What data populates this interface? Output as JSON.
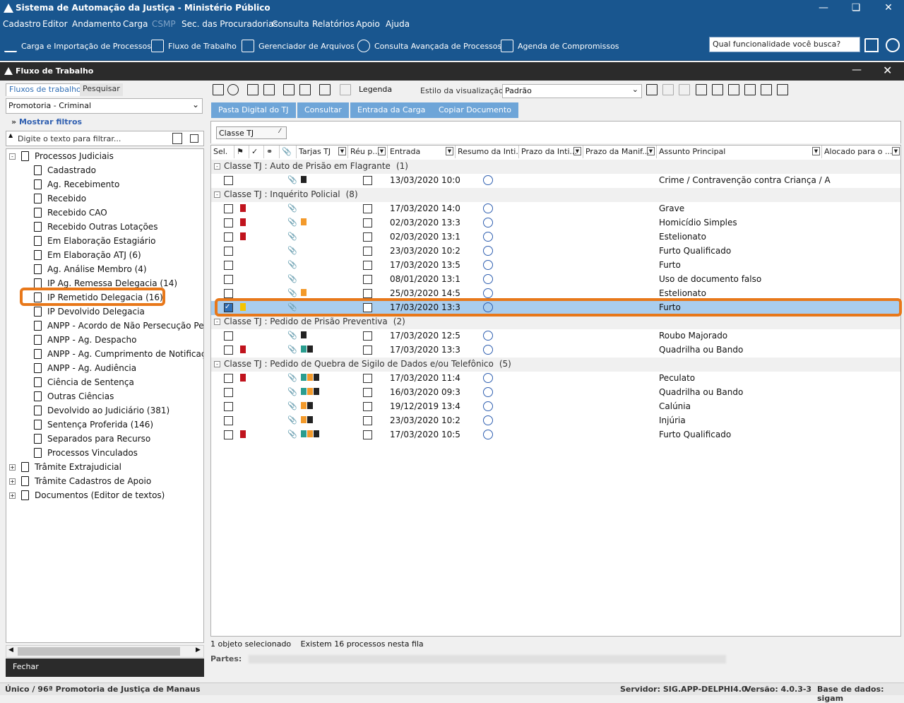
{
  "window": {
    "title": "Sistema de Automação da Justiça - Ministério Público"
  },
  "menu": [
    "Cadastro",
    "Editor",
    "Andamento",
    "Carga",
    "CSMP",
    "Sec. das Procuradorias",
    "Consulta",
    "Relatórios",
    "Apoio",
    "Ajuda"
  ],
  "toolbar": {
    "items": [
      "Carga e Importação de Processos",
      "Fluxo de Trabalho",
      "Gerenciador de Arquivos",
      "Consulta Avançada de Processos",
      "Agenda de Compromissos"
    ],
    "search_placeholder": "Qual funcionalidade você busca?"
  },
  "panel": {
    "title": "Fluxo de Trabalho"
  },
  "left": {
    "tabs": [
      "Fluxos de trabalho",
      "Pesquisar"
    ],
    "combo_value": "Promotoria - Criminal",
    "filters_label": "Mostrar filtros",
    "filter_placeholder": "Digite o texto para filtrar...",
    "tree_root": "Processos Judiciais",
    "tree_items": [
      "Cadastrado",
      "Ag. Recebimento",
      "Recebido",
      "Recebido CAO",
      "Recebido Outras Lotações",
      "Em Elaboração Estagiário",
      "Em Elaboração ATJ (6)",
      "Ag. Análise Membro (4)",
      "IP Ag. Remessa Delegacia (14)",
      "IP Remetido Delegacia (16)",
      "IP Devolvido Delegacia",
      "ANPP - Acordo de Não Persecução Penal",
      "ANPP - Ag. Despacho",
      "ANPP - Ag. Cumprimento de Notificações",
      "ANPP - Ag. Audiência",
      "Ciência de Sentença",
      "Outras Ciências",
      "Devolvido ao Judiciário (381)",
      "Sentença Proferida (146)",
      "Separados para Recurso",
      "Processos Vinculados"
    ],
    "tree_other": [
      "Trâmite Extrajudicial",
      "Trâmite Cadastros de Apoio",
      "Documentos (Editor de textos)"
    ],
    "close_label": "Fechar"
  },
  "right": {
    "legend_label": "Legenda",
    "view_style_label": "Estilo da visualização",
    "view_style_value": "Padrão",
    "buttons": [
      "Pasta Digital do TJ",
      "Consultar",
      "Entrada da Carga",
      "Copiar Documento"
    ],
    "group_chip": "Classe TJ",
    "columns": [
      "Sel.",
      "Tarjas TJ",
      "Réu p...",
      "Entrada",
      "Resumo da Inti...",
      "Prazo da Inti...",
      "Prazo da Manif...",
      "Assunto Principal",
      "Alocado para o ..."
    ],
    "groups": [
      {
        "label": "Classe TJ : Auto de Prisão em Flagrante",
        "count": "(1)",
        "rows": [
          {
            "date": "13/03/2020 10:0",
            "subject": "Crime / Contravenção contra Criança / A",
            "flag": false,
            "tags": [
              "#222222"
            ],
            "checked": false
          }
        ]
      },
      {
        "label": "Classe TJ : Inquérito Policial",
        "count": "(8)",
        "rows": [
          {
            "date": "17/03/2020 14:0",
            "subject": "Grave",
            "flag": true,
            "tags": [],
            "checked": false
          },
          {
            "date": "02/03/2020 13:3",
            "subject": "Homicídio Simples",
            "flag": true,
            "tags": [
              "#f39a2b"
            ],
            "checked": false
          },
          {
            "date": "02/03/2020 13:1",
            "subject": "Estelionato",
            "flag": true,
            "tags": [],
            "checked": false
          },
          {
            "date": "23/03/2020 10:2",
            "subject": "Furto Qualificado",
            "flag": false,
            "tags": [],
            "checked": false
          },
          {
            "date": "17/03/2020 13:5",
            "subject": "Furto",
            "flag": false,
            "tags": [],
            "checked": false
          },
          {
            "date": "08/01/2020 13:1",
            "subject": "Uso de documento falso",
            "flag": false,
            "tags": [],
            "checked": false
          },
          {
            "date": "25/03/2020 14:5",
            "subject": "Estelionato",
            "flag": false,
            "tags": [
              "#f39a2b"
            ],
            "checked": false
          },
          {
            "date": "17/03/2020 13:3",
            "subject": "Furto",
            "flag": false,
            "tags": [],
            "checked": true
          }
        ]
      },
      {
        "label": "Classe TJ : Pedido de Prisão Preventiva",
        "count": "(2)",
        "rows": [
          {
            "date": "17/03/2020 12:5",
            "subject": "Roubo Majorado",
            "flag": false,
            "tags": [
              "#222222"
            ],
            "checked": false
          },
          {
            "date": "17/03/2020 13:3",
            "subject": "Quadrilha ou Bando",
            "flag": true,
            "tags": [
              "#2a9d8f",
              "#222222"
            ],
            "checked": false
          }
        ]
      },
      {
        "label": "Classe TJ : Pedido de Quebra de Sigilo de Dados e/ou Telefônico",
        "count": "(5)",
        "rows": [
          {
            "date": "17/03/2020 11:4",
            "subject": "Peculato",
            "flag": true,
            "tags": [
              "#2a9d8f",
              "#f39a2b",
              "#222222"
            ],
            "checked": false
          },
          {
            "date": "16/03/2020 09:3",
            "subject": "Quadrilha ou Bando",
            "flag": false,
            "tags": [
              "#2a9d8f",
              "#f39a2b",
              "#222222"
            ],
            "checked": false
          },
          {
            "date": "19/12/2019 13:4",
            "subject": "Calúnia",
            "flag": false,
            "tags": [
              "#f39a2b",
              "#222222"
            ],
            "checked": false
          },
          {
            "date": "23/03/2020 10:2",
            "subject": "Injúria",
            "flag": false,
            "tags": [
              "#f39a2b",
              "#222222"
            ],
            "checked": false
          },
          {
            "date": "17/03/2020 10:5",
            "subject": "Furto Qualificado",
            "flag": true,
            "tags": [
              "#2a9d8f",
              "#f39a2b",
              "#222222"
            ],
            "checked": false
          }
        ]
      }
    ],
    "status_selected": "1 objeto selecionado",
    "status_total": "Existem 16 processos nesta fila",
    "partes_label": "Partes:"
  },
  "footer": {
    "left": "Único / 96ª Promotoria de Justiça de Manaus",
    "server": "Servidor: SIG.APP-DELPHI4.0",
    "version": "Versão: 4.0.3-3",
    "database": "Base de dados: sigam"
  },
  "colors": {
    "brand": "#19568f",
    "accent_button": "#6ea5d8",
    "highlight": "#e8781a",
    "selected_row": "#a9cdee",
    "flag": "#c0131d"
  }
}
